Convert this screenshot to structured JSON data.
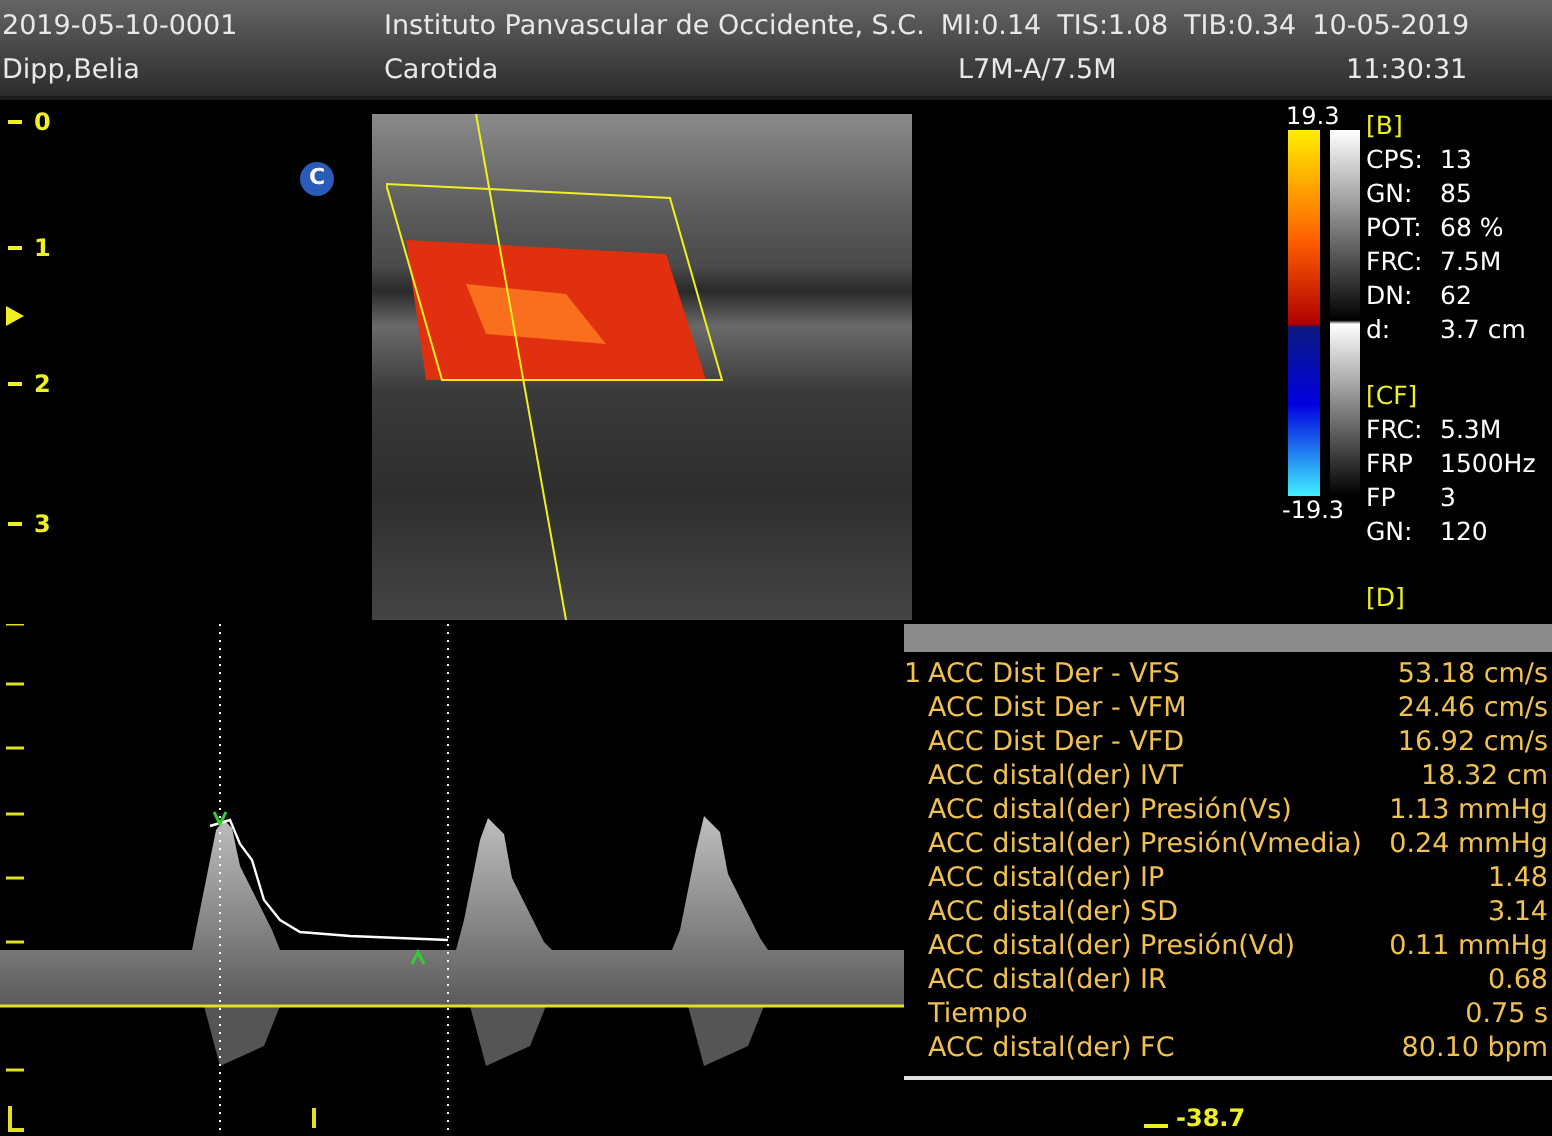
{
  "header": {
    "study_id": "2019-05-10-0001",
    "institution": "Instituto Panvascular de Occidente, S.C.",
    "indices": [
      "MI:0.14",
      "TIS:1.08",
      "TIB:0.34"
    ],
    "date": "10-05-2019",
    "patient": "Dipp,Belia",
    "exam": "Carotida",
    "probe": "L7M-A/7.5M",
    "time": "11:30:31"
  },
  "depth_scale": [
    "0",
    "1",
    "2",
    "3"
  ],
  "mode_badge": "C",
  "color_scale": {
    "max": "19.3",
    "min": "-19.3"
  },
  "params": [
    {
      "title": "[B]",
      "rows": [
        {
          "label": "CPS:",
          "value": "13"
        },
        {
          "label": "GN:",
          "value": "85"
        },
        {
          "label": "POT:",
          "value": "68 %"
        },
        {
          "label": "FRC:",
          "value": "7.5M"
        },
        {
          "label": "DN:",
          "value": "62"
        },
        {
          "label": "d:",
          "value": "3.7 cm"
        }
      ]
    },
    {
      "title": "[CF]",
      "rows": [
        {
          "label": "FRC:",
          "value": "5.3M"
        },
        {
          "label": "FRP",
          "value": "1500Hz"
        },
        {
          "label": "FP",
          "value": "3"
        },
        {
          "label": "GN:",
          "value": "120"
        }
      ]
    },
    {
      "title": "[D]"
    }
  ],
  "measurements": [
    {
      "index": "1",
      "label": "ACC Dist Der - VFS",
      "value": "53.18 cm/s"
    },
    {
      "label": "ACC Dist Der - VFM",
      "value": "24.46 cm/s"
    },
    {
      "label": "ACC Dist Der - VFD",
      "value": "16.92 cm/s"
    },
    {
      "label": "ACC distal(der) IVT",
      "value": "18.32 cm"
    },
    {
      "label": "ACC distal(der) Presión(Vs)",
      "value": "1.13 mmHg"
    },
    {
      "label": "ACC distal(der) Presión(Vmedia)",
      "value": "0.24 mmHg"
    },
    {
      "label": "ACC distal(der) IP",
      "value": "1.48"
    },
    {
      "label": "ACC distal(der) SD",
      "value": "3.14"
    },
    {
      "label": "ACC distal(der) Presión(Vd)",
      "value": "0.11 mmHg"
    },
    {
      "label": "ACC distal(der) IR",
      "value": "0.68"
    },
    {
      "label": "Tiempo",
      "value": "0.75 s"
    },
    {
      "label": "ACC distal(der) FC",
      "value": "80.10 bpm"
    }
  ],
  "velocity_scale_label": "-38.7"
}
